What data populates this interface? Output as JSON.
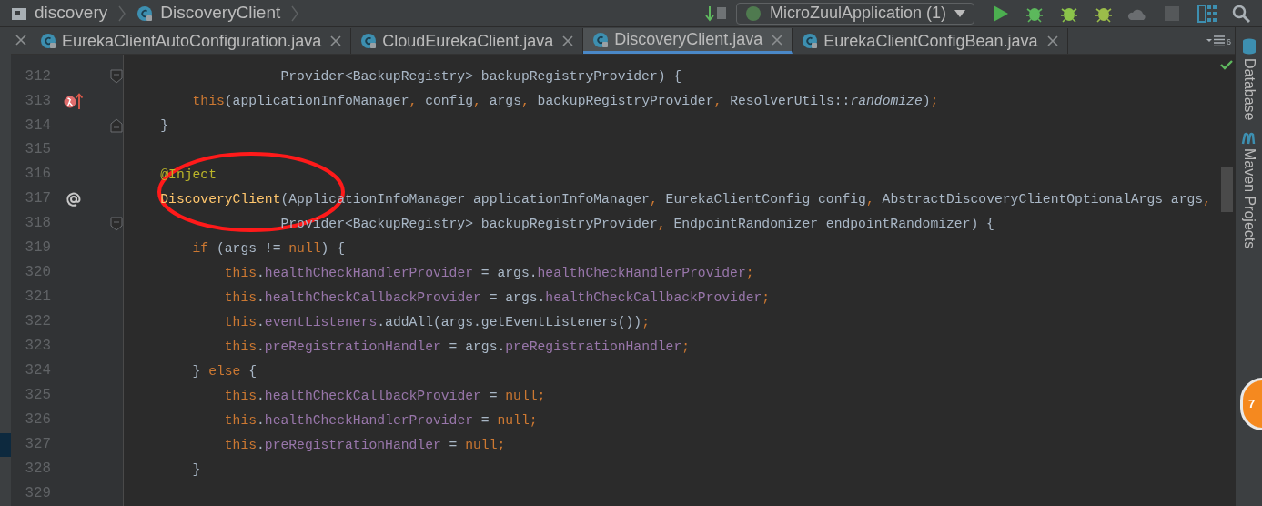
{
  "breadcrumbs": [
    {
      "label": "discovery",
      "kind": "folder"
    },
    {
      "label": "DiscoveryClient",
      "kind": "class"
    }
  ],
  "run_config": {
    "label": "MicroZuulApplication (1)"
  },
  "tabs": [
    {
      "label": "EurekaClientAutoConfiguration.java",
      "selected": false
    },
    {
      "label": "CloudEurekaClient.java",
      "selected": false
    },
    {
      "label": "DiscoveryClient.java",
      "selected": true
    },
    {
      "label": "EurekaClientConfigBean.java",
      "selected": false
    }
  ],
  "tab_overflow_count": "6",
  "lines": [
    {
      "number": "312",
      "fold_start": true,
      "tokens": [
        {
          "kind": "plain",
          "text": "                   Provider<BackupRegistry> backupRegistryProvider) {"
        }
      ]
    },
    {
      "number": "313",
      "overrides": true,
      "tokens": [
        {
          "kind": "kw",
          "text": "        this"
        },
        {
          "kind": "plain",
          "text": "(applicationInfoManager"
        },
        {
          "kind": "kw",
          "text": ", "
        },
        {
          "kind": "plain",
          "text": "config"
        },
        {
          "kind": "kw",
          "text": ", "
        },
        {
          "kind": "plain",
          "text": "args"
        },
        {
          "kind": "kw",
          "text": ", "
        },
        {
          "kind": "plain",
          "text": "backupRegistryProvider"
        },
        {
          "kind": "kw",
          "text": ", "
        },
        {
          "kind": "plain",
          "text": "ResolverUtils::"
        },
        {
          "kind": "italic",
          "text": "randomize"
        },
        {
          "kind": "plain",
          "text": ")"
        },
        {
          "kind": "kw",
          "text": ";"
        }
      ]
    },
    {
      "number": "314",
      "fold_end": true,
      "tokens": [
        {
          "kind": "plain",
          "text": "    }"
        }
      ]
    },
    {
      "number": "315"
    },
    {
      "number": "316",
      "tokens": [
        {
          "kind": "anno",
          "text": "    @Inject"
        }
      ]
    },
    {
      "number": "317",
      "injection_point": true,
      "tokens": [
        {
          "kind": "decl",
          "text": "    DiscoveryClient"
        },
        {
          "kind": "plain",
          "text": "(ApplicationInfoManager applicationInfoManager"
        },
        {
          "kind": "kw",
          "text": ", "
        },
        {
          "kind": "plain",
          "text": "EurekaClientConfig config"
        },
        {
          "kind": "kw",
          "text": ", "
        },
        {
          "kind": "plain",
          "text": "AbstractDiscoveryClientOptionalArgs args"
        },
        {
          "kind": "kw",
          "text": ","
        }
      ]
    },
    {
      "number": "318",
      "fold_start": true,
      "tokens": [
        {
          "kind": "plain",
          "text": "                   Provider<BackupRegistry> backupRegistryProvider"
        },
        {
          "kind": "kw",
          "text": ", "
        },
        {
          "kind": "plain",
          "text": "EndpointRandomizer endpointRandomizer) {"
        }
      ]
    },
    {
      "number": "319",
      "tokens": [
        {
          "kind": "kw",
          "text": "        if "
        },
        {
          "kind": "plain",
          "text": "(args != "
        },
        {
          "kind": "kw",
          "text": "null"
        },
        {
          "kind": "plain",
          "text": ") {"
        }
      ]
    },
    {
      "number": "320",
      "tokens": [
        {
          "kind": "kw",
          "text": "            this"
        },
        {
          "kind": "plain",
          "text": "."
        },
        {
          "kind": "field",
          "text": "healthCheckHandlerProvider"
        },
        {
          "kind": "plain",
          "text": " = args."
        },
        {
          "kind": "field",
          "text": "healthCheckHandlerProvider"
        },
        {
          "kind": "kw",
          "text": ";"
        }
      ]
    },
    {
      "number": "321",
      "tokens": [
        {
          "kind": "kw",
          "text": "            this"
        },
        {
          "kind": "plain",
          "text": "."
        },
        {
          "kind": "field",
          "text": "healthCheckCallbackProvider"
        },
        {
          "kind": "plain",
          "text": " = args."
        },
        {
          "kind": "field",
          "text": "healthCheckCallbackProvider"
        },
        {
          "kind": "kw",
          "text": ";"
        }
      ]
    },
    {
      "number": "322",
      "tokens": [
        {
          "kind": "kw",
          "text": "            this"
        },
        {
          "kind": "plain",
          "text": "."
        },
        {
          "kind": "field",
          "text": "eventListeners"
        },
        {
          "kind": "plain",
          "text": ".addAll(args.getEventListeners())"
        },
        {
          "kind": "kw",
          "text": ";"
        }
      ]
    },
    {
      "number": "323",
      "tokens": [
        {
          "kind": "kw",
          "text": "            this"
        },
        {
          "kind": "plain",
          "text": "."
        },
        {
          "kind": "field",
          "text": "preRegistrationHandler"
        },
        {
          "kind": "plain",
          "text": " = args."
        },
        {
          "kind": "field",
          "text": "preRegistrationHandler"
        },
        {
          "kind": "kw",
          "text": ";"
        }
      ]
    },
    {
      "number": "324",
      "tokens": [
        {
          "kind": "plain",
          "text": "        } "
        },
        {
          "kind": "kw",
          "text": "else "
        },
        {
          "kind": "plain",
          "text": "{"
        }
      ]
    },
    {
      "number": "325",
      "tokens": [
        {
          "kind": "kw",
          "text": "            this"
        },
        {
          "kind": "plain",
          "text": "."
        },
        {
          "kind": "field",
          "text": "healthCheckCallbackProvider"
        },
        {
          "kind": "plain",
          "text": " = "
        },
        {
          "kind": "kw",
          "text": "null;"
        }
      ]
    },
    {
      "number": "326",
      "tokens": [
        {
          "kind": "kw",
          "text": "            this"
        },
        {
          "kind": "plain",
          "text": "."
        },
        {
          "kind": "field",
          "text": "healthCheckHandlerProvider"
        },
        {
          "kind": "plain",
          "text": " = "
        },
        {
          "kind": "kw",
          "text": "null;"
        }
      ]
    },
    {
      "number": "327",
      "tokens": [
        {
          "kind": "kw",
          "text": "            this"
        },
        {
          "kind": "plain",
          "text": "."
        },
        {
          "kind": "field",
          "text": "preRegistrationHandler"
        },
        {
          "kind": "plain",
          "text": " = "
        },
        {
          "kind": "kw",
          "text": "null;"
        }
      ]
    },
    {
      "number": "328",
      "tokens": [
        {
          "kind": "plain",
          "text": "        }"
        }
      ]
    },
    {
      "number": "329"
    }
  ],
  "side_tools": [
    {
      "label": "Database",
      "kind": "database"
    },
    {
      "label": "Maven Projects",
      "kind": "maven"
    }
  ],
  "notification_badge": "7"
}
